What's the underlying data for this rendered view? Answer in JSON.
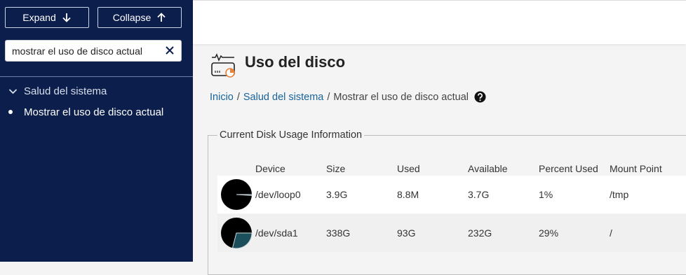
{
  "sidebar": {
    "expand_label": "Expand",
    "collapse_label": "Collapse",
    "search_value": "mostrar el uso de disco actual",
    "group_label": "Salud del sistema",
    "item_label": "Mostrar el uso de disco actual"
  },
  "page": {
    "title": "Uso del disco",
    "breadcrumb": [
      "Inicio",
      "Salud del sistema",
      "Mostrar el uso de disco actual"
    ]
  },
  "panel": {
    "legend": "Current Disk Usage Information",
    "columns": [
      "Device",
      "Size",
      "Used",
      "Available",
      "Percent Used",
      "Mount Point"
    ],
    "rows": [
      {
        "device": "/dev/loop0",
        "size": "3.9G",
        "used": "8.8M",
        "available": "3.7G",
        "percent": "1%",
        "mount": "/tmp",
        "percent_value": 0.01
      },
      {
        "device": "/dev/sda1",
        "size": "338G",
        "used": "93G",
        "available": "232G",
        "percent": "29%",
        "mount": "/",
        "percent_value": 0.29
      }
    ]
  },
  "colors": {
    "sidebar_bg": "#0b1e4c",
    "link": "#17639b",
    "pie_fill": "#000000",
    "pie_used": "#1b4f5c",
    "pie_stroke": "#cfd8dc"
  }
}
